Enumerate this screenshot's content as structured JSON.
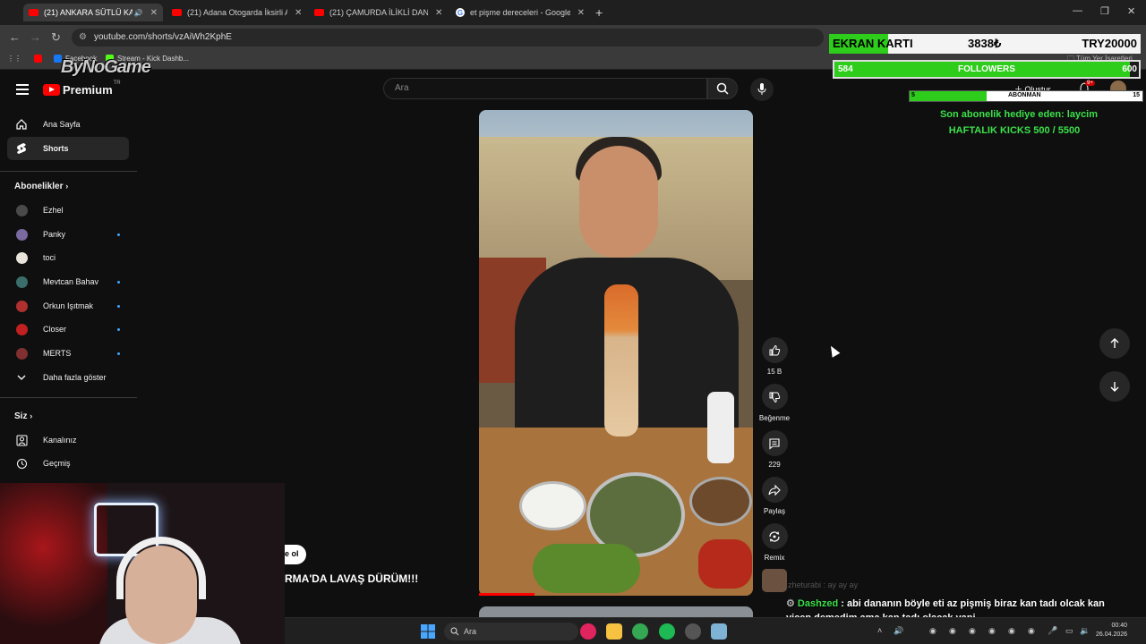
{
  "tabs": [
    {
      "label": "(21) ANKARA SÜTLÜ KAVURMA",
      "active": true
    },
    {
      "label": "(21) Adana Otogarda İksirli Ayran",
      "active": false
    },
    {
      "label": "(21) ÇAMURDA İLİKLİ DANA İNCİK",
      "active": false
    },
    {
      "label": "et pişme dereceleri - Google'da ara",
      "active": false
    }
  ],
  "address": "youtube.com/shorts/vzAiWh2KphE",
  "bookmarks": [
    "Facebook",
    "Stream - Kick Dashb..."
  ],
  "bookmarks_right": "Tüm Yer İşaretleri",
  "overlay_logo": "ByNoGame",
  "youtube": {
    "brand": "Premium",
    "region": "TR",
    "search_placeholder": "Ara",
    "create_label": "Oluştur",
    "notif_count": "9+"
  },
  "sidebar": {
    "main": [
      {
        "label": "Ana Sayfa",
        "icon": "home-icon"
      },
      {
        "label": "Shorts",
        "icon": "shorts-icon",
        "active": true
      }
    ],
    "subs_title": "Abonelikler",
    "subs": [
      {
        "label": "Ezhel",
        "color": "#4a4a4a",
        "dot": false
      },
      {
        "label": "Panky",
        "color": "#7a6aa0",
        "dot": true
      },
      {
        "label": "toci",
        "color": "#e8e4dc",
        "dot": false
      },
      {
        "label": "Mevtcan Bahav",
        "color": "#3a6e6a",
        "dot": true
      },
      {
        "label": "Orkun Işıtmak",
        "color": "#b03030",
        "dot": true
      },
      {
        "label": "Closer",
        "color": "#c02020",
        "dot": true
      },
      {
        "label": "MERTS",
        "color": "#803030",
        "dot": true
      }
    ],
    "show_more": "Daha fazla göster",
    "you_title": "Siz",
    "you": [
      {
        "label": "Kanalınız",
        "icon": "channel-icon"
      },
      {
        "label": "Geçmiş",
        "icon": "history-icon"
      }
    ]
  },
  "actions": {
    "like_count": "15 B",
    "dislike_label": "Beğenme",
    "comments_count": "229",
    "share_label": "Paylaş",
    "remix_label": "Remix"
  },
  "video_caption_partial": "e ol",
  "video_title_partial": "RMA'DA LAVAŞ DÜRÜM!!!",
  "overlay": {
    "ekran_label": "EKRAN KARTI",
    "ekran_value": "3838₺",
    "ekran_target": "TRY20000",
    "ekran_fill": 0.19,
    "followers_current": "584",
    "followers_label": "FOLLOWERS",
    "followers_goal": "600",
    "followers_fill": 0.97,
    "abone_current": "5",
    "abone_label": "ABONMAN",
    "abone_goal": "15",
    "abone_fill": 0.33,
    "last_gift": "Son abonelik hediye eden: laycim",
    "weekly_kicks": "HAFTALIK KICKS 500 / 5500"
  },
  "chat": [
    {
      "user": "zheturabi",
      "message": "ay ay ay"
    },
    {
      "user": "Dashzed",
      "message": "abi dananın böyle eti az pişmiş biraz kan tadı olcak kan yicen demedim ama kan tadı olacak yani."
    }
  ],
  "taskbar": {
    "search_label": "Ara",
    "time": "00:40",
    "date": "26.04.2026"
  }
}
